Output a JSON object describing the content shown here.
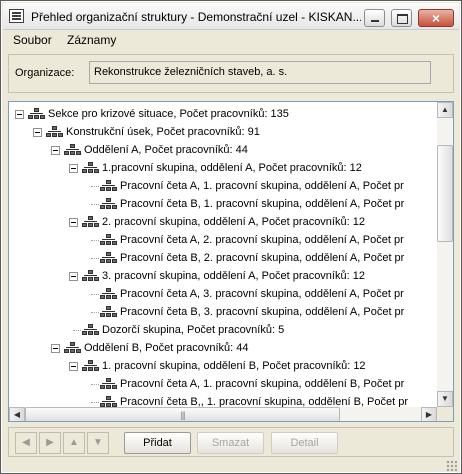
{
  "window": {
    "title": "Přehled organizační struktury - Demonstrační uzel - KISKAN...",
    "close_label": "×"
  },
  "menu": {
    "items": [
      "Soubor",
      "Záznamy"
    ]
  },
  "organization": {
    "label": "Organizace:",
    "value": "Rekonstrukce železničních staveb, a. s."
  },
  "tree": {
    "nodes": [
      {
        "label": "Sekce pro krizové situace, Počet pracovníků: 135",
        "level": 0,
        "expanded": true
      },
      {
        "label": "Konstrukční úsek, Počet pracovníků: 91",
        "level": 1,
        "expanded": true
      },
      {
        "label": "Oddělení A, Počet pracovníků: 44",
        "level": 2,
        "expanded": true
      },
      {
        "label": "1.pracovní skupina, oddělení A, Počet pracovníků: 12",
        "level": 3,
        "expanded": true
      },
      {
        "label": "Pracovní četa A, 1. pracovní skupina, oddělení A, Počet pr",
        "level": 4,
        "expanded": false
      },
      {
        "label": "Pracovní četa B, 1. pracovní skupina, oddělení A, Počet pr",
        "level": 4,
        "expanded": false
      },
      {
        "label": "2. pracovní skupina, oddělení A, Počet pracovníků: 12",
        "level": 3,
        "expanded": true
      },
      {
        "label": "Pracovní četa A, 2. pracovní skupina, oddělení A, Počet pr",
        "level": 4,
        "expanded": false
      },
      {
        "label": "Pracovní četa B, 2. pracovní skupina, oddělení A, Počet pr",
        "level": 4,
        "expanded": false
      },
      {
        "label": "3. pracovní skupina, oddělení A, Počet pracovníků: 12",
        "level": 3,
        "expanded": true
      },
      {
        "label": "Pracovní četa A, 3. pracovní skupina, oddělení A, Počet pr",
        "level": 4,
        "expanded": false
      },
      {
        "label": "Pracovní četa B, 3. pracovní skupina, oddělení A, Počet pr",
        "level": 4,
        "expanded": false
      },
      {
        "label": "Dozorčí skupina, Počet pracovníků: 5",
        "level": 3,
        "expanded": false
      },
      {
        "label": "Oddělení B, Počet pracovníků: 44",
        "level": 2,
        "expanded": true
      },
      {
        "label": "1. pracovní skupina, oddělení B, Počet pracovníků: 12",
        "level": 3,
        "expanded": true
      },
      {
        "label": "Pracovní četa A, 1. pracovní skupina, oddělení B, Počet pr",
        "level": 4,
        "expanded": false
      },
      {
        "label": "Pracovní četa B,, 1. pracovní skupina, oddělení B, Počet pr",
        "level": 4,
        "expanded": false
      }
    ],
    "node_icon": "org-unit-icon"
  },
  "toolbar": {
    "nav_first": "◀",
    "nav_prev": "▶",
    "nav_up": "▲",
    "nav_down": "▼",
    "add_label": "Přidat",
    "delete_label": "Smazat",
    "detail_label": "Detail"
  },
  "scroll": {
    "up": "▲",
    "down": "▼",
    "left": "◀",
    "right": "▶",
    "grip": "|||"
  },
  "colors": {
    "window_bg": "#ece9d8",
    "tree_border": "#7f9db9",
    "close_button": "#c8503a"
  }
}
